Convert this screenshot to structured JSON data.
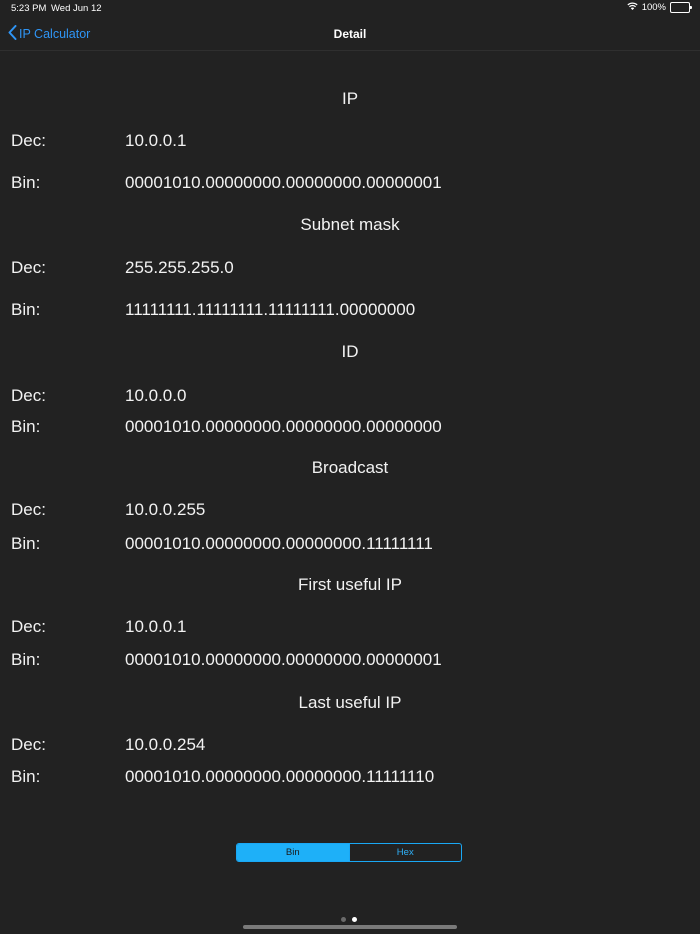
{
  "status_bar": {
    "time": "5:23 PM",
    "date": "Wed Jun 12",
    "battery": "100%"
  },
  "nav": {
    "back_label": "IP Calculator",
    "title": "Detail"
  },
  "sections": {
    "ip": {
      "title": "IP",
      "dec_label": "Dec:",
      "dec": "10.0.0.1",
      "bin_label": "Bin:",
      "bin": "00001010.00000000.00000000.00000001"
    },
    "subnet": {
      "title": "Subnet mask",
      "dec_label": "Dec:",
      "dec": "255.255.255.0",
      "bin_label": "Bin:",
      "bin": "11111111.11111111.11111111.00000000"
    },
    "id": {
      "title": "ID",
      "dec_label": "Dec:",
      "dec": "10.0.0.0",
      "bin_label": "Bin:",
      "bin": "00001010.00000000.00000000.00000000"
    },
    "broadcast": {
      "title": "Broadcast",
      "dec_label": "Dec:",
      "dec": "10.0.0.255",
      "bin_label": "Bin:",
      "bin": "00001010.00000000.00000000.11111111"
    },
    "first": {
      "title": "First useful IP",
      "dec_label": "Dec:",
      "dec": "10.0.0.1",
      "bin_label": "Bin:",
      "bin": "00001010.00000000.00000000.00000001"
    },
    "last": {
      "title": "Last useful IP",
      "dec_label": "Dec:",
      "dec": "10.0.0.254",
      "bin_label": "Bin:",
      "bin": "00001010.00000000.00000000.11111110"
    }
  },
  "segmented": {
    "options": [
      "Bin",
      "Hex"
    ],
    "selected": "Bin"
  },
  "pager": {
    "count": 2,
    "current": 2
  },
  "colors": {
    "background": "#222222",
    "accent": "#1eb0f8",
    "link": "#2f95f5"
  }
}
